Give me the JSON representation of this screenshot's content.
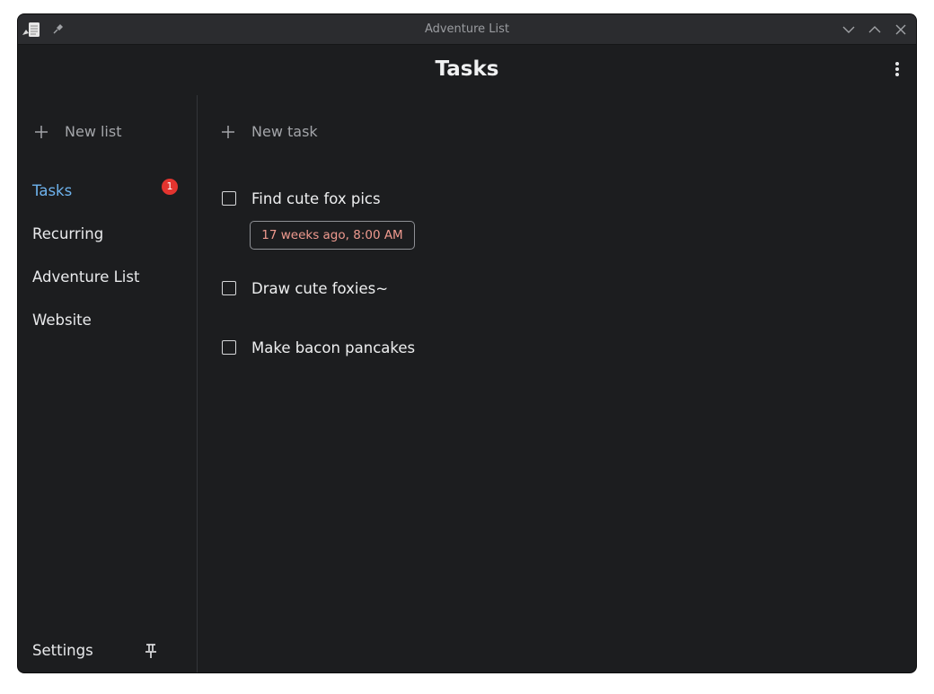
{
  "window": {
    "title": "Adventure List"
  },
  "header": {
    "title": "Tasks"
  },
  "sidebar": {
    "new_list_label": "New list",
    "items": [
      {
        "label": "Tasks",
        "active": true,
        "badge": "1"
      },
      {
        "label": "Recurring"
      },
      {
        "label": "Adventure List"
      },
      {
        "label": "Website"
      }
    ],
    "settings_label": "Settings"
  },
  "main": {
    "new_task_label": "New task",
    "tasks": [
      {
        "label": "Find cute fox pics",
        "checked": false,
        "due": "17 weeks ago, 8:00 AM"
      },
      {
        "label": "Draw cute foxies~",
        "checked": false
      },
      {
        "label": "Make bacon pancakes",
        "checked": false
      }
    ]
  },
  "colors": {
    "background": "#1c1d1f",
    "titlebar": "#2b2c2f",
    "accent": "#6eb3ee",
    "badge": "#e3342f",
    "overdue": "#ef9a8f"
  }
}
